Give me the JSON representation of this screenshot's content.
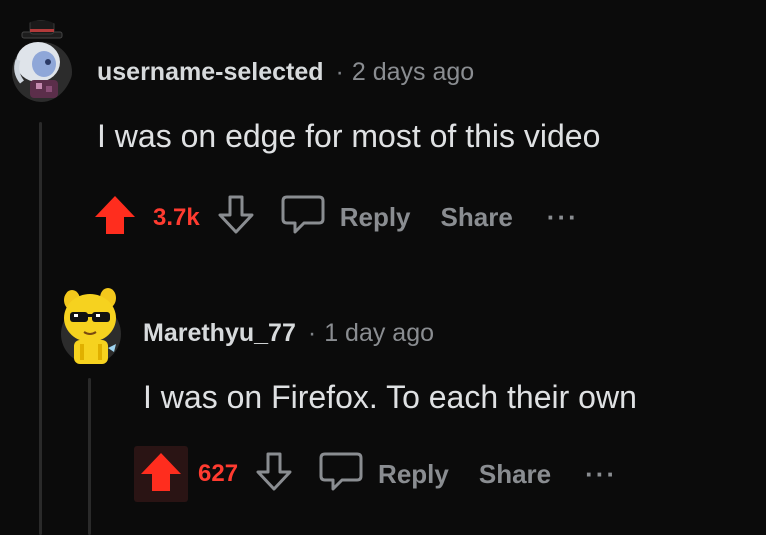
{
  "comments": [
    {
      "username": "username-selected",
      "separator": "·",
      "time": "2 days ago",
      "body": "I was on edge for most of this video",
      "score": "3.7k",
      "reply_label": "Reply",
      "share_label": "Share",
      "more_label": "···"
    },
    {
      "username": "Marethyu_77",
      "separator": "·",
      "time": "1 day ago",
      "body": "I was on Firefox. To each their own",
      "score": "627",
      "reply_label": "Reply",
      "share_label": "Share",
      "more_label": "···"
    }
  ],
  "colors": {
    "background": "#0b0b0b",
    "upvote_active": "#ff2d1e",
    "muted": "#8a8d91",
    "thread_line": "#2a2a2a"
  },
  "icons": [
    "upvote-arrow-icon",
    "downvote-arrow-icon",
    "reply-bubble-icon",
    "more-options-icon"
  ]
}
